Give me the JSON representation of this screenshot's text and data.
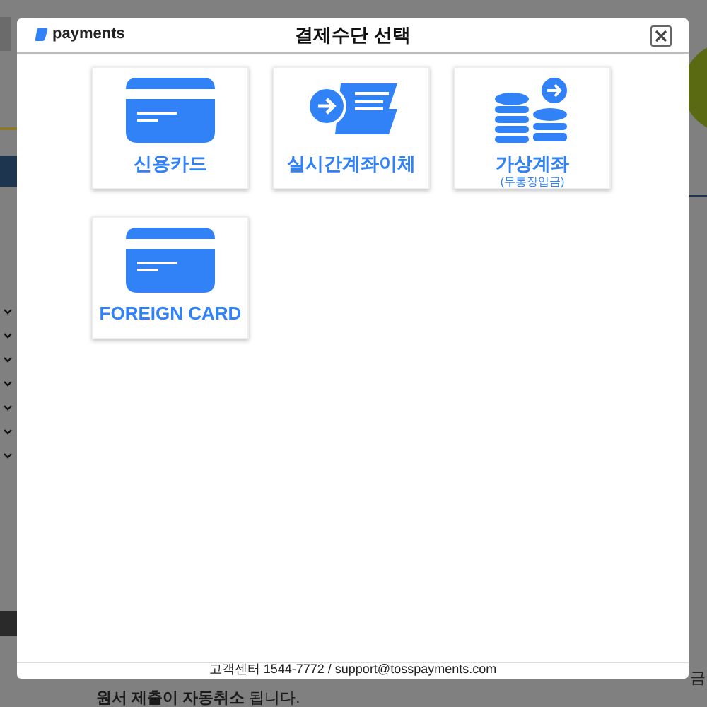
{
  "background": {
    "notice": "**원서 제출이 자동취소** 됩니다.",
    "edge_text": "금"
  },
  "modal": {
    "logo": "payments",
    "title": "결제수단 선택",
    "methods": [
      {
        "kind": "card",
        "label": "신용카드"
      },
      {
        "kind": "transfer",
        "label": "실시간계좌이체"
      },
      {
        "kind": "virtual",
        "label": "가상계좌",
        "sublabel": "(무통장입금)"
      },
      {
        "kind": "card",
        "label": "FOREIGN CARD"
      }
    ],
    "footer": "고객센터 1544-7772 / support@tosspayments.com"
  }
}
